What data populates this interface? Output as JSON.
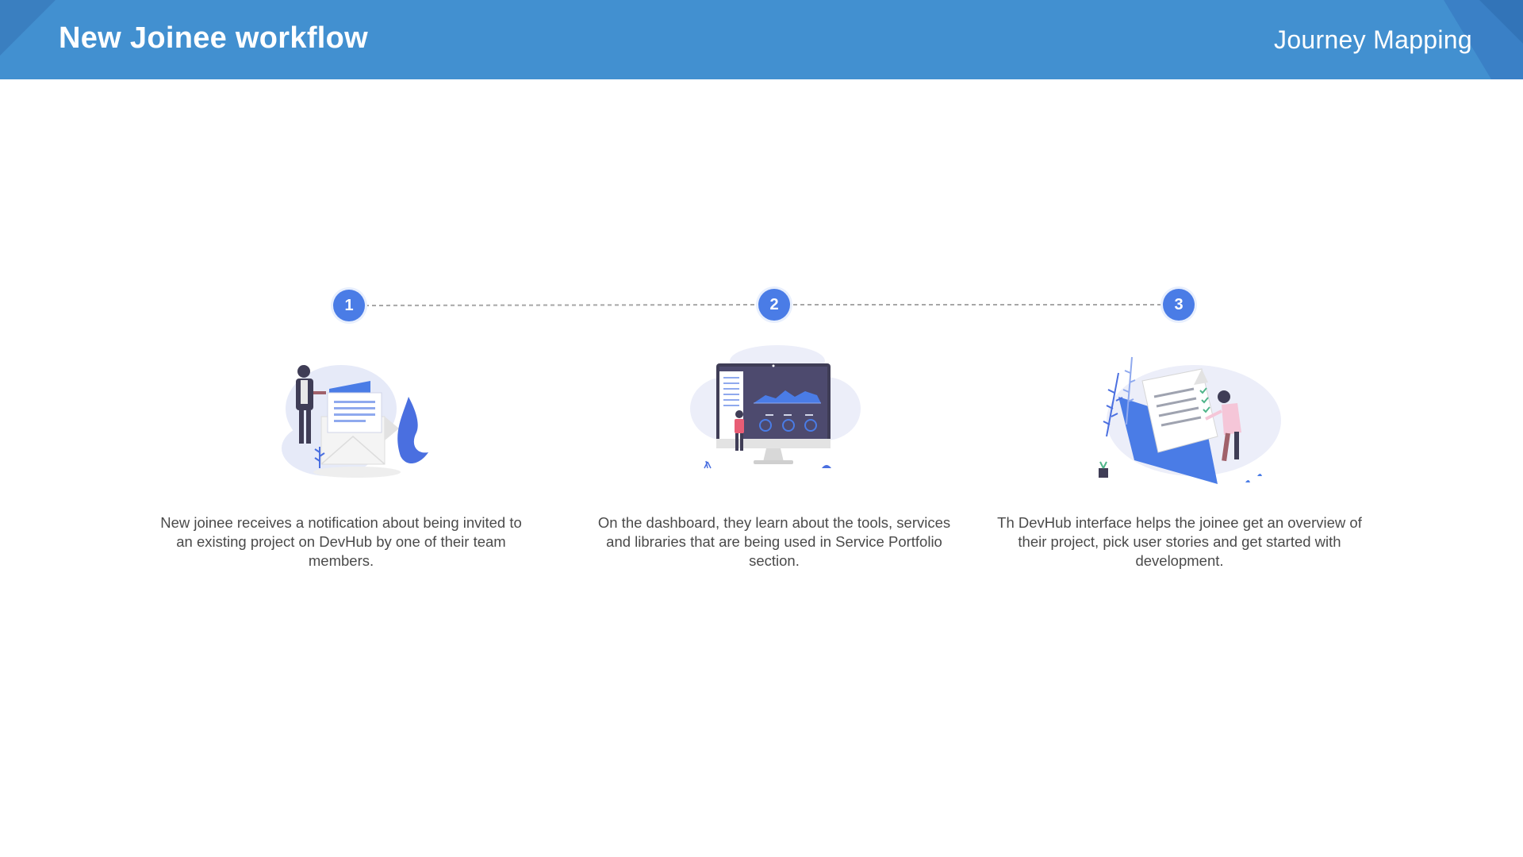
{
  "header": {
    "title": "New Joinee workflow",
    "subtitle": "Journey Mapping"
  },
  "colors": {
    "header_bg": "#4290d0",
    "accent": "#4a7ce6",
    "text": "#4a4a4a"
  },
  "steps": [
    {
      "number": "1",
      "icon": "envelope-notification-illustration",
      "description": "New joinee receives a notification about being invited to an existing project on DevHub by one of their team members."
    },
    {
      "number": "2",
      "icon": "dashboard-monitor-illustration",
      "description": "On the dashboard, they learn about the tools, services and libraries that are being used in Service Portfolio section."
    },
    {
      "number": "3",
      "icon": "document-review-illustration",
      "description": "Th DevHub interface helps the joinee get an overview of their project, pick user stories and get started with development."
    }
  ]
}
